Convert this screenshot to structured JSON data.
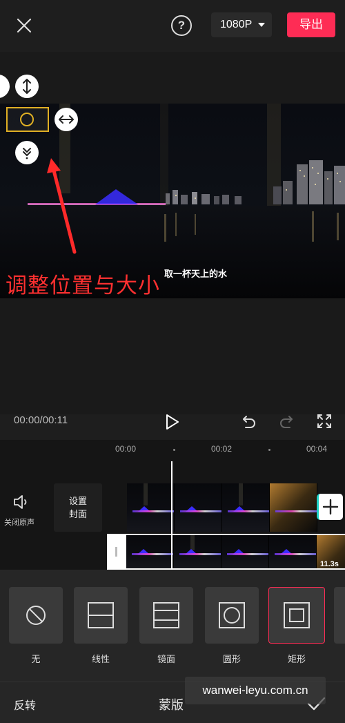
{
  "header": {
    "help_icon_text": "?",
    "resolution": "1080P",
    "export_label": "导出"
  },
  "preview": {
    "annotation": "调整位置与大小",
    "subtitle": "取一杯天上的水"
  },
  "playback": {
    "time": "00:00/00:11"
  },
  "timeline": {
    "ticks": [
      "00:00",
      "00:02",
      "00:04"
    ],
    "mute_label": "关闭原声",
    "cover_line1": "设置",
    "cover_line2": "封面",
    "duration": "11.3s"
  },
  "masks": {
    "options": [
      {
        "label": "无",
        "icon": "prohibited-icon"
      },
      {
        "label": "线性",
        "icon": "linear-mask-icon"
      },
      {
        "label": "镜面",
        "icon": "mirror-mask-icon"
      },
      {
        "label": "圆形",
        "icon": "circle-mask-icon"
      },
      {
        "label": "矩形",
        "icon": "rectangle-mask-icon"
      }
    ],
    "selected": "矩形"
  },
  "bottom": {
    "invert_label": "反转",
    "title": "蒙版"
  },
  "watermark": "wanwei-leyu.com.cn",
  "colors": {
    "accent": "#fe2c55",
    "mask_handle": "#e0b024",
    "annotation": "#ff3030"
  }
}
